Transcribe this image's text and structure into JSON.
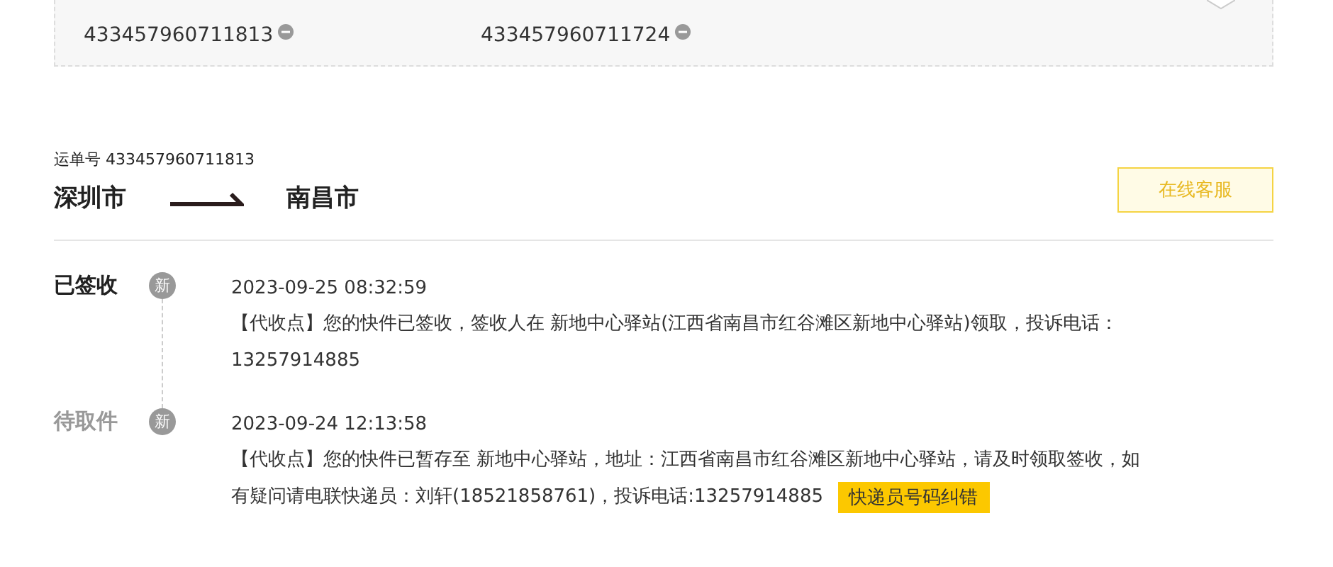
{
  "tracking_numbers": [
    {
      "number": "433457960711813"
    },
    {
      "number": "433457960711724"
    }
  ],
  "waybill": {
    "label": "运单号 433457960711813",
    "origin": "深圳市",
    "destination": "南昌市"
  },
  "service_button": "在线客服",
  "events": [
    {
      "status": "已签收",
      "current": true,
      "badge": "新",
      "time": "2023-09-25 08:32:59",
      "lines": [
        "【代收点】您的快件已签收，签收人在 新地中心驿站(江西省南昌市红谷滩区新地中心驿站)领取，投诉电话：",
        "13257914885"
      ]
    },
    {
      "status": "待取件",
      "current": false,
      "badge": "新",
      "time": "2023-09-24 12:13:58",
      "lines": [
        "【代收点】您的快件已暂存至 新地中心驿站，地址：江西省南昌市红谷滩区新地中心驿站，请及时领取签收，如",
        "有疑问请电联快递员：刘轩(18521858761)，投诉电话:13257914885"
      ],
      "action": "快递员号码纠错"
    }
  ]
}
